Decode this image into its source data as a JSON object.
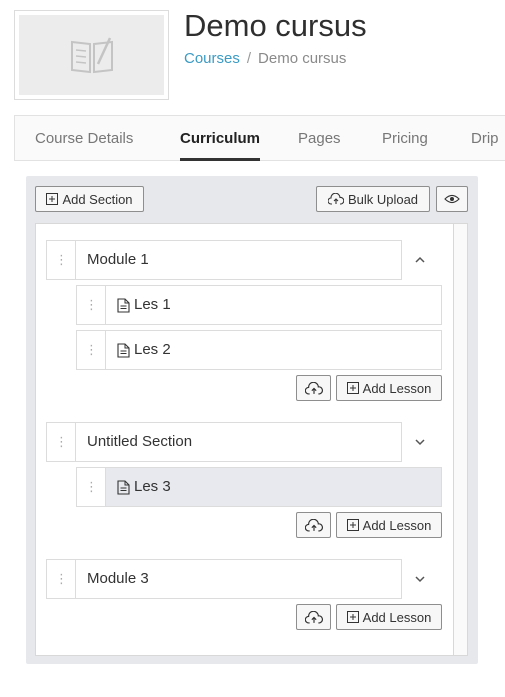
{
  "header": {
    "title": "Demo cursus",
    "breadcrumb": {
      "parent": "Courses",
      "separator": "/",
      "current": "Demo cursus"
    },
    "thumbnail_icon": "book-pen-icon"
  },
  "tabs": [
    {
      "label": "Course Details",
      "active": false
    },
    {
      "label": "Curriculum",
      "active": true
    },
    {
      "label": "Pages",
      "active": false
    },
    {
      "label": "Pricing",
      "active": false
    },
    {
      "label": "Drip",
      "active": false
    }
  ],
  "toolbar": {
    "add_section_label": "Add Section",
    "bulk_upload_label": "Bulk Upload",
    "preview_icon": "eye-icon"
  },
  "sections": [
    {
      "title": "Module 1",
      "expanded": true,
      "chevron_icon": "chevron-up-icon",
      "lessons": [
        {
          "title": "Les 1"
        },
        {
          "title": "Les 2"
        }
      ],
      "add_lesson_label": "Add Lesson"
    },
    {
      "title": "Untitled Section",
      "expanded": true,
      "chevron_icon": "chevron-down-icon",
      "lessons": [
        {
          "title": "Les 3",
          "highlighted": true
        }
      ],
      "add_lesson_label": "Add Lesson"
    },
    {
      "title": "Module 3",
      "expanded": false,
      "chevron_icon": "chevron-down-icon",
      "lessons": [],
      "add_lesson_label": "Add Lesson"
    }
  ],
  "colors": {
    "link": "#3b9bc4",
    "panel_bg": "#e6e8ec",
    "highlight_row": "#e7e9ee"
  }
}
